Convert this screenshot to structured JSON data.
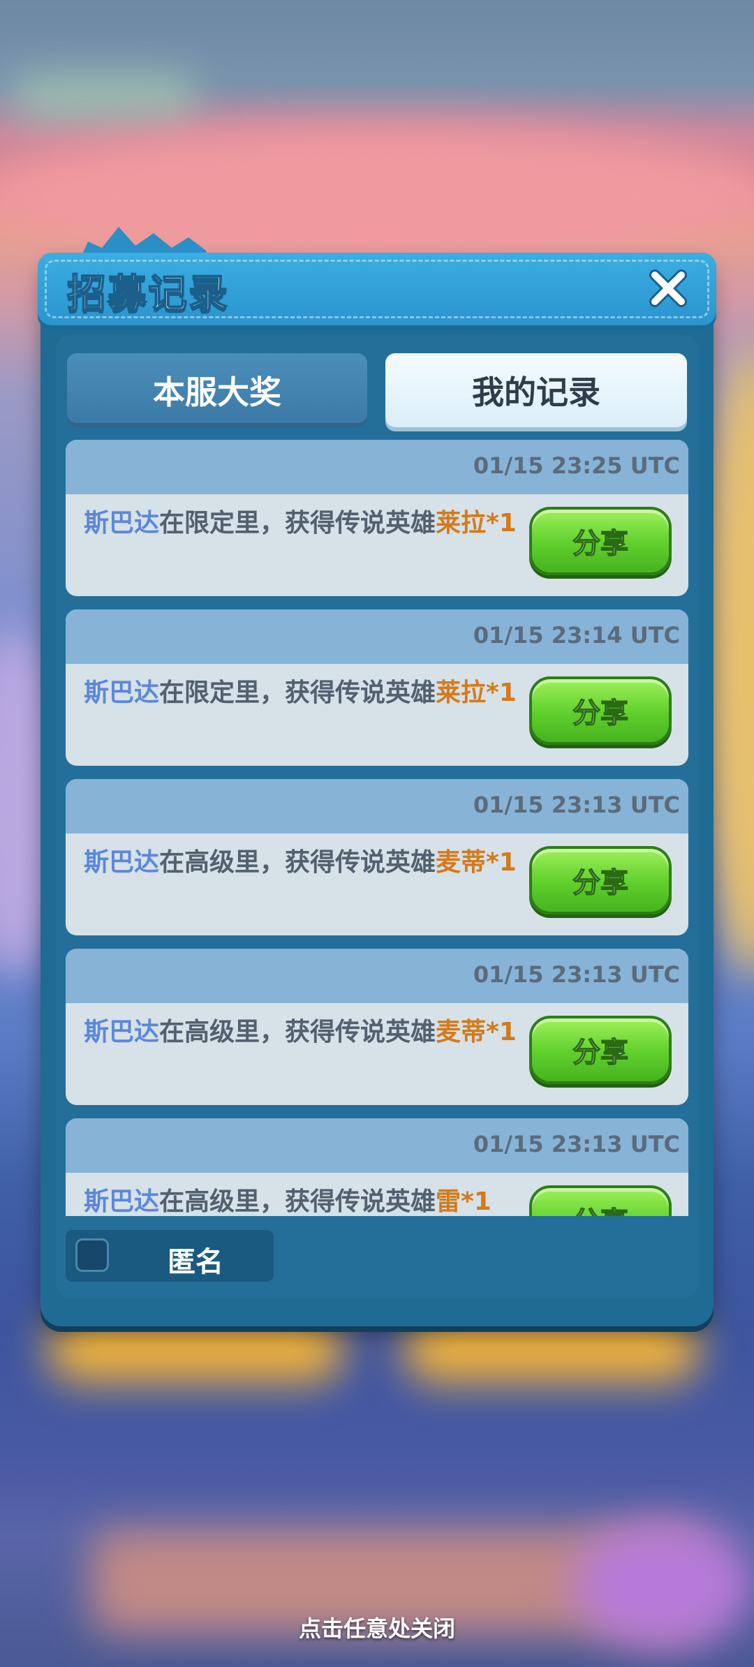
{
  "dialog": {
    "title": "招募记录",
    "close_icon": "close-x-icon"
  },
  "tabs": [
    {
      "label": "本服大奖",
      "active": false
    },
    {
      "label": "我的记录",
      "active": true
    }
  ],
  "records": [
    {
      "time": "01/15 23:25 UTC",
      "player": "斯巴达",
      "middle": "在限定里，获得传说英雄",
      "hero": "莱拉*1",
      "share_label": "分享"
    },
    {
      "time": "01/15 23:14 UTC",
      "player": "斯巴达",
      "middle": "在限定里，获得传说英雄",
      "hero": "莱拉*1",
      "share_label": "分享"
    },
    {
      "time": "01/15 23:13 UTC",
      "player": "斯巴达",
      "middle": "在高级里，获得传说英雄",
      "hero": "麦蒂*1",
      "share_label": "分享"
    },
    {
      "time": "01/15 23:13 UTC",
      "player": "斯巴达",
      "middle": "在高级里，获得传说英雄",
      "hero": "麦蒂*1",
      "share_label": "分享"
    },
    {
      "time": "01/15 23:13 UTC",
      "player": "斯巴达",
      "middle": "在高级里，获得传说英雄",
      "hero": "雷*1",
      "share_label": "分享"
    }
  ],
  "anonymous": {
    "label": "匿名",
    "checked": false
  },
  "footer_hint": "点击任意处关闭",
  "colors": {
    "dialog_bg": "#1f6b93",
    "title_bar": "#2b94cd",
    "player_name": "#5c87d9",
    "hero_name": "#d47a1a",
    "share_button": "#5fcf2c"
  }
}
